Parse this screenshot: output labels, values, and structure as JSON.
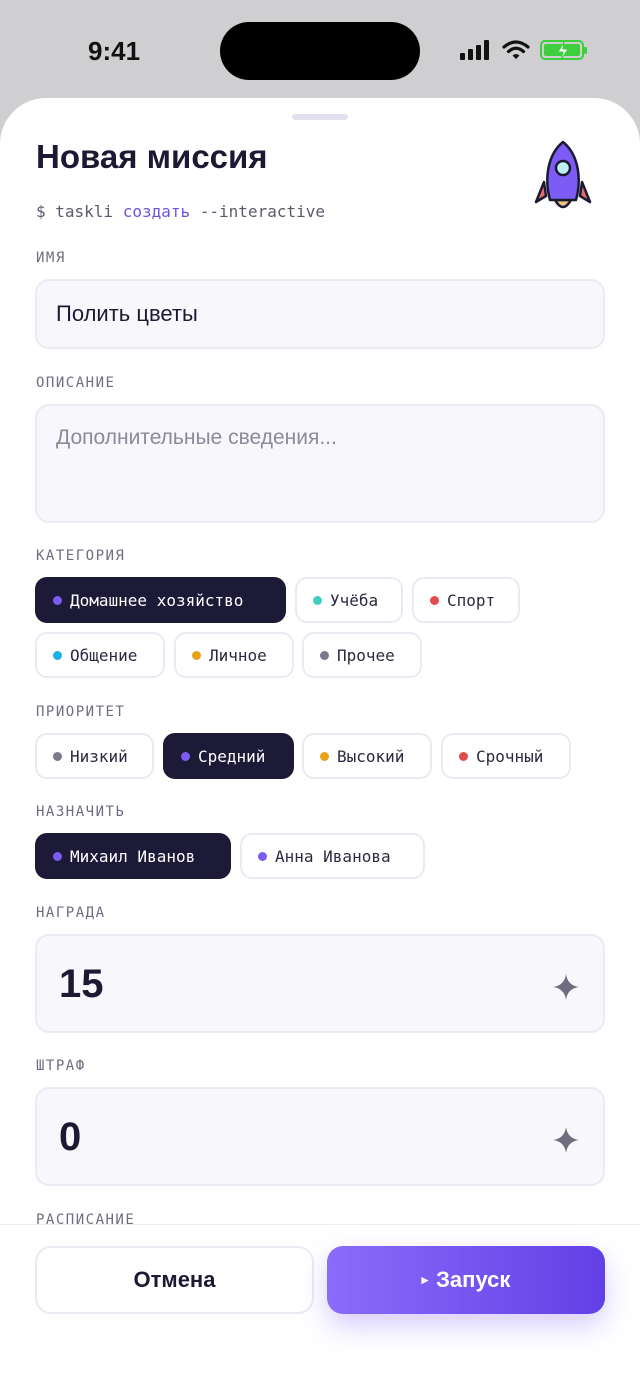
{
  "status_bar": {
    "time": "9:41",
    "colors": {
      "battery": "#3ecf3e"
    }
  },
  "header": {
    "title": "Новая миссия",
    "command": {
      "prefix": "$ taskli ",
      "verb": "создать",
      "flag": " --interactive"
    }
  },
  "form": {
    "name": {
      "label": "ИМЯ",
      "value": "Полить цветы"
    },
    "description": {
      "label": "ОПИСАНИЕ",
      "placeholder": "Дополнительные сведения..."
    },
    "category": {
      "label": "КАТЕГОРИЯ",
      "options": [
        {
          "label": "Домашнее хозяйство",
          "color": "#7c5cf5",
          "selected": true
        },
        {
          "label": "Учёба",
          "color": "#3ecfc0",
          "selected": false
        },
        {
          "label": "Спорт",
          "color": "#e24c4c",
          "selected": false
        },
        {
          "label": "Общение",
          "color": "#1ab0e8",
          "selected": false
        },
        {
          "label": "Личное",
          "color": "#e8a21a",
          "selected": false
        },
        {
          "label": "Прочее",
          "color": "#7a7a8a",
          "selected": false
        }
      ]
    },
    "priority": {
      "label": "ПРИОРИТЕТ",
      "options": [
        {
          "label": "Низкий",
          "color": "#7a7a8a",
          "selected": false
        },
        {
          "label": "Средний",
          "color": "#7c5cf5",
          "selected": true
        },
        {
          "label": "Высокий",
          "color": "#e8a21a",
          "selected": false
        },
        {
          "label": "Срочный",
          "color": "#e24c4c",
          "selected": false
        }
      ]
    },
    "assignee": {
      "label": "НАЗНАЧИТЬ",
      "options": [
        {
          "label": "Михаил Иванов",
          "color": "#7c5cf5",
          "selected": true
        },
        {
          "label": "Анна Иванова",
          "color": "#7c5cf5",
          "selected": false
        }
      ]
    },
    "reward": {
      "label": "НАГРАДА",
      "value": "15"
    },
    "penalty": {
      "label": "ШТРАФ",
      "value": "0"
    },
    "schedule": {
      "label": "РАСПИСАНИЕ"
    }
  },
  "footer": {
    "cancel_label": "Отмена",
    "launch_icon": "▸",
    "launch_label": "Запуск"
  },
  "icons": [
    "signal-icon",
    "wifi-icon",
    "battery-charging-icon",
    "rocket-icon",
    "sparkle-icon",
    "play-icon"
  ]
}
